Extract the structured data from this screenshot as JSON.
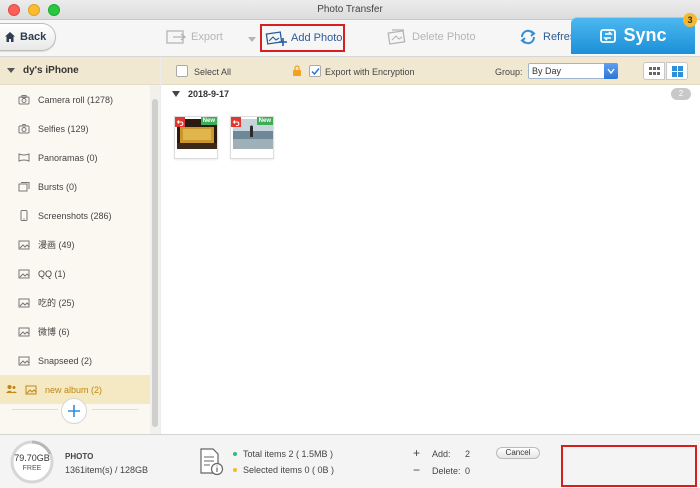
{
  "window": {
    "title": "Photo Transfer"
  },
  "toolbar": {
    "back_label": "Back",
    "export_label": "Export",
    "add_photo_label": "Add Photo",
    "delete_photo_label": "Delete Photo",
    "refresh_label": "Refresh"
  },
  "sidebar": {
    "device_name": "dy's iPhone",
    "albums": [
      {
        "label": "Camera roll (1278)",
        "icon": "camera-icon"
      },
      {
        "label": "Selfies (129)",
        "icon": "selfie-icon"
      },
      {
        "label": "Panoramas (0)",
        "icon": "panorama-icon"
      },
      {
        "label": "Bursts (0)",
        "icon": "burst-icon"
      },
      {
        "label": "Screenshots (286)",
        "icon": "phone-icon"
      },
      {
        "label": "漫画 (49)",
        "icon": "album-icon"
      },
      {
        "label": "QQ (1)",
        "icon": "album-icon"
      },
      {
        "label": "吃的 (25)",
        "icon": "album-icon"
      },
      {
        "label": "微博 (6)",
        "icon": "album-icon"
      },
      {
        "label": "Snapseed (2)",
        "icon": "album-icon"
      },
      {
        "label": "new album (2)",
        "icon": "album-icon",
        "selected": true
      }
    ]
  },
  "content": {
    "select_all_label": "Select All",
    "export_encryption_label": "Export with Encryption",
    "group_label": "Group:",
    "group_value": "By Day",
    "date_group": {
      "date": "2018-9-17",
      "count": "2"
    },
    "photos": [
      {
        "badge": "New"
      },
      {
        "badge": "New"
      }
    ]
  },
  "bottom": {
    "storage_free_value": "79.70GB",
    "storage_free_label": "FREE",
    "category_label": "PHOTO",
    "usage_text": "1361item(s) / 128GB",
    "total_items": "Total items 2 ( 1.5MB )",
    "selected_items": "Selected items 0 ( 0B )",
    "add_label": "Add:",
    "add_value": "2",
    "delete_label": "Delete:",
    "delete_value": "0",
    "cancel_label": "Cancel",
    "sync_label": "Sync",
    "sync_badge": "3"
  },
  "colors": {
    "accent_blue": "#2b5b9b",
    "sync_blue": "#1c8fd8",
    "highlight_red": "#d62020",
    "sidebar_header": "#f0e8d0",
    "selected_album": "#c0860f"
  }
}
